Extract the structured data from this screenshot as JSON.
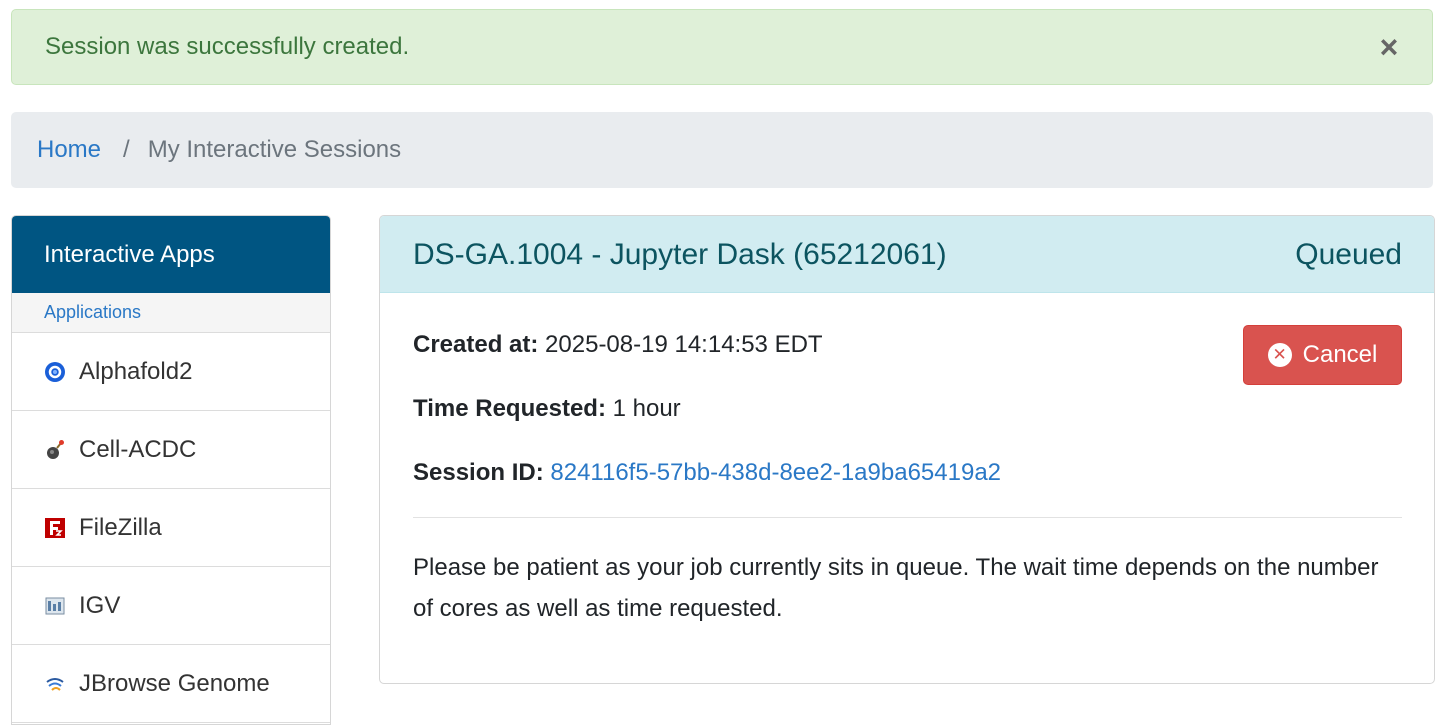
{
  "alert": {
    "message": "Session was successfully created.",
    "close_symbol": "×"
  },
  "breadcrumb": {
    "home": "Home",
    "separator": "/",
    "current": "My Interactive Sessions"
  },
  "sidebar": {
    "title": "Interactive Apps",
    "section": "Applications",
    "items": [
      {
        "label": "Alphafold2",
        "icon": "alphafold-icon"
      },
      {
        "label": "Cell-ACDC",
        "icon": "cell-acdc-icon"
      },
      {
        "label": "FileZilla",
        "icon": "filezilla-icon"
      },
      {
        "label": "IGV",
        "icon": "igv-icon"
      },
      {
        "label": "JBrowse Genome",
        "icon": "jbrowse-icon"
      }
    ]
  },
  "session": {
    "title": "DS-GA.1004 - Jupyter Dask (65212061)",
    "status": "Queued",
    "created_label": "Created at:",
    "created_value": "2025-08-19 14:14:53 EDT",
    "time_label": "Time Requested:",
    "time_value": "1 hour",
    "id_label": "Session ID:",
    "id_value": "824116f5-57bb-438d-8ee2-1a9ba65419a2",
    "cancel_label": "Cancel",
    "message": "Please be patient as your job currently sits in queue. The wait time depends on the number of cores as well as time requested."
  },
  "colors": {
    "alert_bg": "#dff0d8",
    "alert_text": "#3c763d",
    "sidebar_header": "#005582",
    "panel_head": "#d1ecf1",
    "panel_title": "#0c5460",
    "danger": "#d9534f",
    "link": "#2a78c6"
  }
}
